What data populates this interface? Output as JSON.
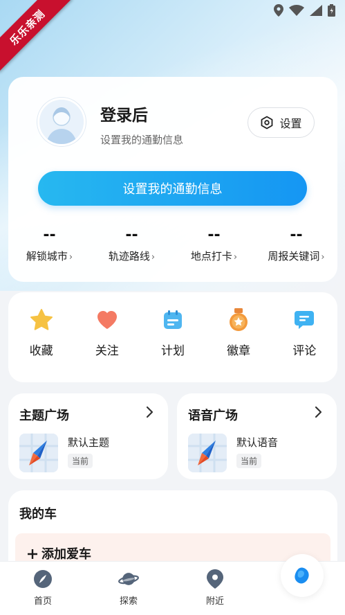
{
  "status_bar": {
    "ribbon_text": "乐乐亲测"
  },
  "profile": {
    "title": "登录后",
    "subtitle": "设置我的通勤信息",
    "settings_label": "设置",
    "cta_label": "设置我的通勤信息",
    "stats": [
      {
        "value": "--",
        "label": "解锁城市"
      },
      {
        "value": "--",
        "label": "轨迹路线"
      },
      {
        "value": "--",
        "label": "地点打卡"
      },
      {
        "value": "--",
        "label": "周报关键词"
      }
    ]
  },
  "shortcuts": [
    {
      "label": "收藏",
      "icon": "star-icon",
      "color": "#f6c243"
    },
    {
      "label": "关注",
      "icon": "heart-icon",
      "color": "#f47a63"
    },
    {
      "label": "计划",
      "icon": "calendar-icon",
      "color": "#4fb6f0"
    },
    {
      "label": "徽章",
      "icon": "medal-icon",
      "color": "#f39a3c"
    },
    {
      "label": "评论",
      "icon": "comment-icon",
      "color": "#3fb2f2"
    }
  ],
  "theme_plaza": {
    "title": "主题广场",
    "item_name": "默认主题",
    "item_badge": "当前"
  },
  "voice_plaza": {
    "title": "语音广场",
    "item_name": "默认语音",
    "item_badge": "当前"
  },
  "my_car": {
    "title": "我的车",
    "add_label": "添加爱车"
  },
  "tabbar": {
    "tabs": [
      {
        "label": "首页",
        "icon": "compass-icon"
      },
      {
        "label": "探索",
        "icon": "planet-icon"
      },
      {
        "label": "附近",
        "icon": "location-pin-icon"
      }
    ]
  },
  "colors": {
    "accent": "#1596f3",
    "accent_light": "#27b8f0",
    "ribbon": "#c8102e"
  }
}
